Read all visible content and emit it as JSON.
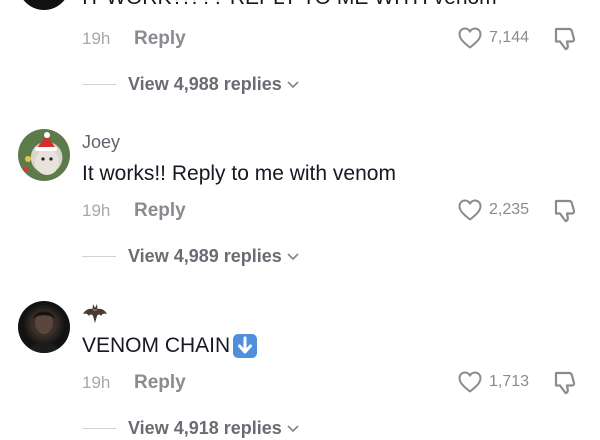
{
  "comments": [
    {
      "text": "IT WORK?!??? REPLY TO ME WITH venom",
      "time": "19h",
      "reply_label": "Reply",
      "likes": "7,144",
      "view_replies": "View 4,988 replies"
    },
    {
      "username": "Joey",
      "text": "It works!! Reply to me with venom",
      "time": "19h",
      "reply_label": "Reply",
      "likes": "2,235",
      "view_replies": "View 4,989 replies"
    },
    {
      "text": "VENOM CHAIN",
      "time": "19h",
      "reply_label": "Reply",
      "likes": "1,713",
      "view_replies": "View 4,918 replies"
    }
  ],
  "icons": {
    "like": "heart-outline-icon",
    "dislike": "thumbs-down-icon",
    "expand": "chevron-down-icon",
    "username_badge": "bat-icon",
    "emoji": "down-arrow-emoji-icon"
  }
}
